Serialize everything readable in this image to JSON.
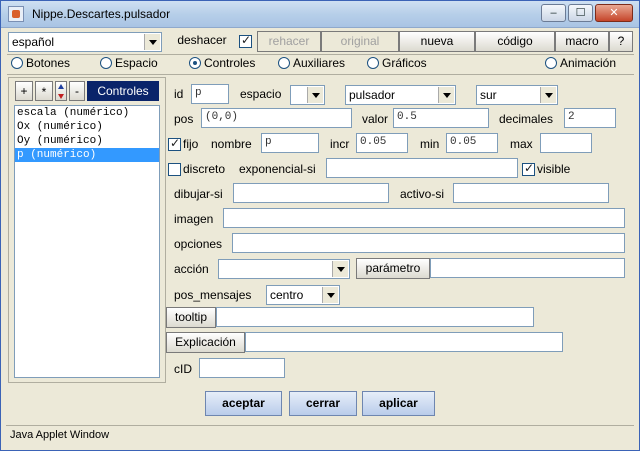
{
  "window": {
    "title": "Nippe.Descartes.pulsador"
  },
  "toolbar": {
    "language": "español",
    "deshacer": "deshacer",
    "rehacer": "rehacer",
    "original": "original",
    "nueva": "nueva",
    "codigo": "código",
    "macro": "macro",
    "help": "?"
  },
  "tabs": [
    {
      "label": "Botones",
      "selected": false
    },
    {
      "label": "Espacio",
      "selected": false
    },
    {
      "label": "Controles",
      "selected": true
    },
    {
      "label": "Auxiliares",
      "selected": false
    },
    {
      "label": "Gráficos",
      "selected": false
    },
    {
      "label": "Animación",
      "selected": false
    }
  ],
  "left": {
    "add": "+",
    "dup": "*",
    "del": "-",
    "panel_label": "Controles",
    "items": [
      "escala (numérico)",
      "Ox (numérico)",
      "Oy (numérico)",
      "p (numérico)"
    ]
  },
  "form": {
    "id_label": "id",
    "id_value": "p",
    "espacio_label": "espacio",
    "espacio_value": "",
    "tipo_value": "pulsador",
    "region_value": "sur",
    "pos_label": "pos",
    "pos_value": "(0,0)",
    "valor_label": "valor",
    "valor_value": "0.5",
    "decimales_label": "decimales",
    "decimales_value": "2",
    "fijo_label": "fijo",
    "nombre_label": "nombre",
    "nombre_value": "p",
    "incr_label": "incr",
    "incr_value": "0.05",
    "min_label": "min",
    "min_value": "0.05",
    "max_label": "max",
    "max_value": "",
    "discreto_label": "discreto",
    "exponencial_label": "exponencial-si",
    "exponencial_value": "",
    "visible_label": "visible",
    "dibujar_label": "dibujar-si",
    "dibujar_value": "",
    "activo_label": "activo-si",
    "activo_value": "",
    "imagen_label": "imagen",
    "imagen_value": "",
    "opciones_label": "opciones",
    "opciones_value": "",
    "accion_label": "acción",
    "accion_value": "",
    "parametro_label": "parámetro",
    "parametro_value": "",
    "posmsg_label": "pos_mensajes",
    "posmsg_value": "centro",
    "tooltip_label": "tooltip",
    "tooltip_value": "",
    "explicacion_label": "Explicación",
    "explicacion_value": "",
    "cid_label": "cID",
    "cid_value": ""
  },
  "footer": {
    "aceptar": "aceptar",
    "cerrar": "cerrar",
    "aplicar": "aplicar",
    "status": "Java Applet Window"
  }
}
